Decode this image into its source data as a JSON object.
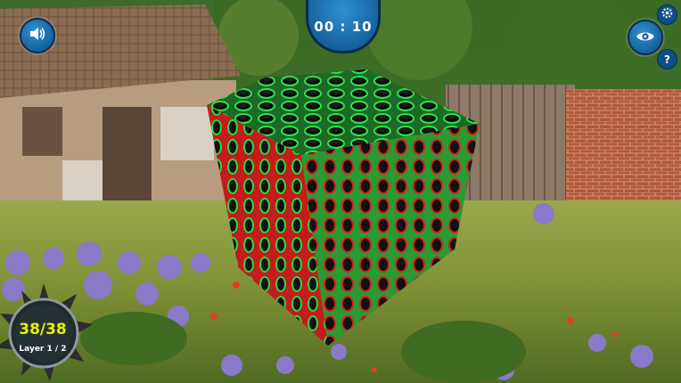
{
  "hud": {
    "timer": "00 : 10",
    "progress_count": "38/38",
    "progress_layer": "Layer 1 / 2",
    "icons": {
      "sound": "speaker-icon",
      "view": "eye-icon",
      "settings": "gear-icon",
      "help": "question-icon"
    },
    "help_glyph": "?",
    "colors": {
      "button_blue": "#1a6fb0",
      "progress_text": "#e8f000",
      "cube_green": "#22c93a",
      "cube_red": "#c21a1a"
    }
  }
}
